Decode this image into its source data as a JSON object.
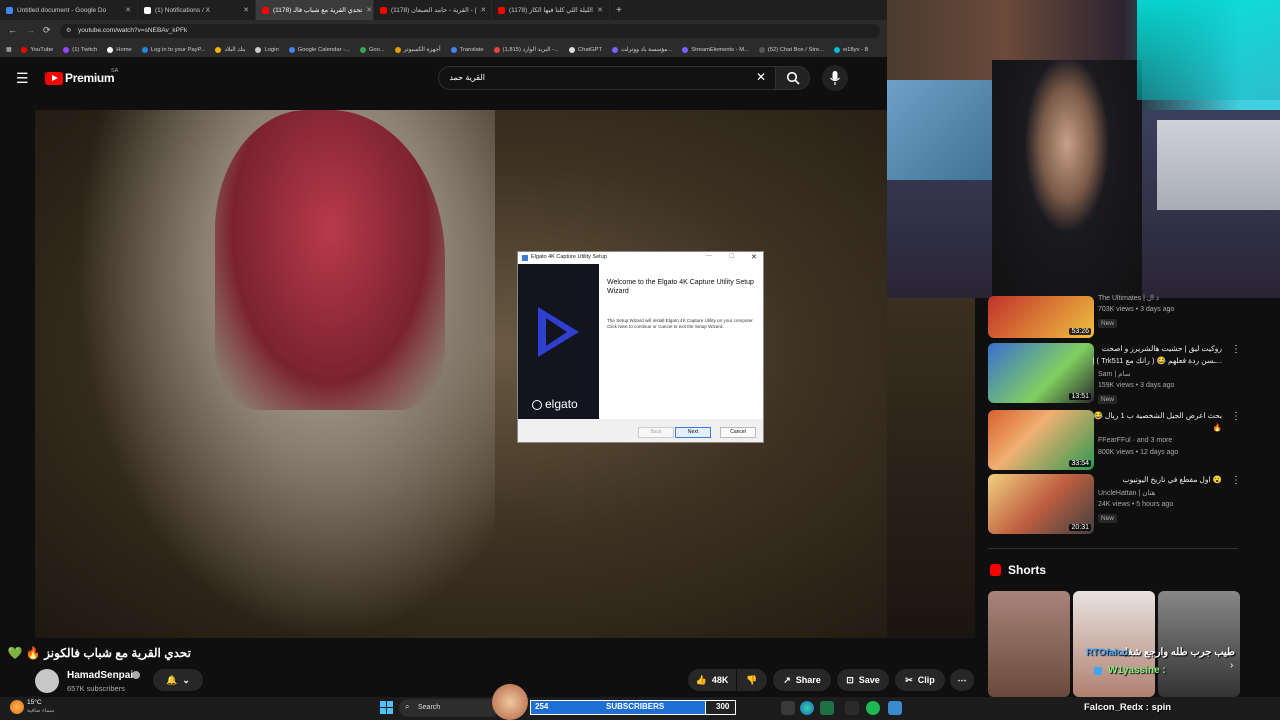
{
  "browser": {
    "tabs": [
      {
        "title": "Untitled document - Google Do",
        "color": "#4285f4"
      },
      {
        "title": "(1) Notifications / X",
        "color": "#ffffff"
      },
      {
        "title": "(1178) تحدي القرية مع شباب فالـ",
        "color": "#ff0000",
        "active": true
      },
      {
        "title": "(1178) القرية - حامد الضبعان - |",
        "color": "#ff0000"
      },
      {
        "title": "(1178) الليلة اللي كلنا فيها الكار",
        "color": "#ff0000"
      }
    ],
    "new_tab": "+",
    "url": "youtube.com/watch?v=sNEBAv_kPFk",
    "bookmarks": [
      "YouTube",
      "(1) Twitch",
      "Home",
      "Log in to your PayP...",
      "بنك البلاد",
      "Login",
      "Google Calendar -...",
      "Goo...",
      "أجهزة الكمبيوتر",
      "Translate",
      "(1,815) البريد الوارد -...",
      "ChatGPT",
      "مؤسسة باد ووترلت...",
      "StreamElements - M...",
      "(52) Chat Box / Stre...",
      "w18yv - B"
    ]
  },
  "youtube": {
    "logo": "Premium",
    "region": "SA",
    "search_value": "القرية حمد",
    "video_title": "تحدي القرية مع شباب فالكونز 🔥 💚",
    "channel": "HamadSenpai",
    "subscribers": "657K subscribers",
    "likes": "48K",
    "share": "Share",
    "save": "Save",
    "clip": "Clip",
    "shorts_heading": "Shorts"
  },
  "dialog": {
    "title": "Elgato 4K Capture Utility Setup",
    "heading": "Welcome to the Elgato 4K Capture Utility Setup Wizard",
    "body": "The Setup Wizard will install Elgato 4K Capture Utility on your computer. Click Next to continue or Cancel to exit the Setup Wizard.",
    "brand": "elgato",
    "back": "Back",
    "next": "Next",
    "cancel": "Cancel"
  },
  "recommendations": [
    {
      "title": "",
      "channel": "The Ultimates | ذ ال",
      "meta": "703K views • 3 days ago",
      "badge": "New",
      "duration": "53:26"
    },
    {
      "title": "روكيت ليق | حشيت هالشريرز و اصحت",
      "title2": "...ـسن ردة فعلهم 😂 ( رانك مع Trk511 ) |",
      "channel": "Sam | سام",
      "meta": "159K views • 3 days ago",
      "badge": "New",
      "duration": "13:51"
    },
    {
      "title": "بحث اعرض الجيل الشخصية ب 1 ريال 😂",
      "title2": "🔥",
      "channel": "FFearFFul",
      "channel_extra": "and 3 more",
      "meta": "800K views • 12 days ago",
      "duration": "33:54"
    },
    {
      "title": "😮 اول مقطع في تاريخ اليوتيوب",
      "channel": "UncleHattan | هتان",
      "meta": "24K views • 5 hours ago",
      "badge": "New",
      "duration": "20:31"
    }
  ],
  "shorts": [
    {
      "caption": ""
    },
    {
      "caption": "طيب جرب طله وارجع شغله"
    },
    {
      "caption": ""
    }
  ],
  "overlay": {
    "chat_name": "RTOfalco",
    "chat_user": "W1yassine :",
    "chat_bottom": "Falcon_Redx : spin",
    "sub_count_left": "254",
    "sub_label": "SUBSCRIBERS",
    "sub_count_right": "300"
  },
  "taskbar": {
    "weather_temp": "15°C",
    "weather_desc": "سماء صافية",
    "search": "Search",
    "pinned": [
      "windows",
      "search",
      "store",
      "edge",
      "excel",
      "premiere",
      "spotify",
      "app"
    ]
  },
  "colors": {
    "yt_red": "#ff0000",
    "accent_blue": "#3ea6ff",
    "sub_bar": "#1d6fd3",
    "chat_green": "#7ff07f"
  }
}
